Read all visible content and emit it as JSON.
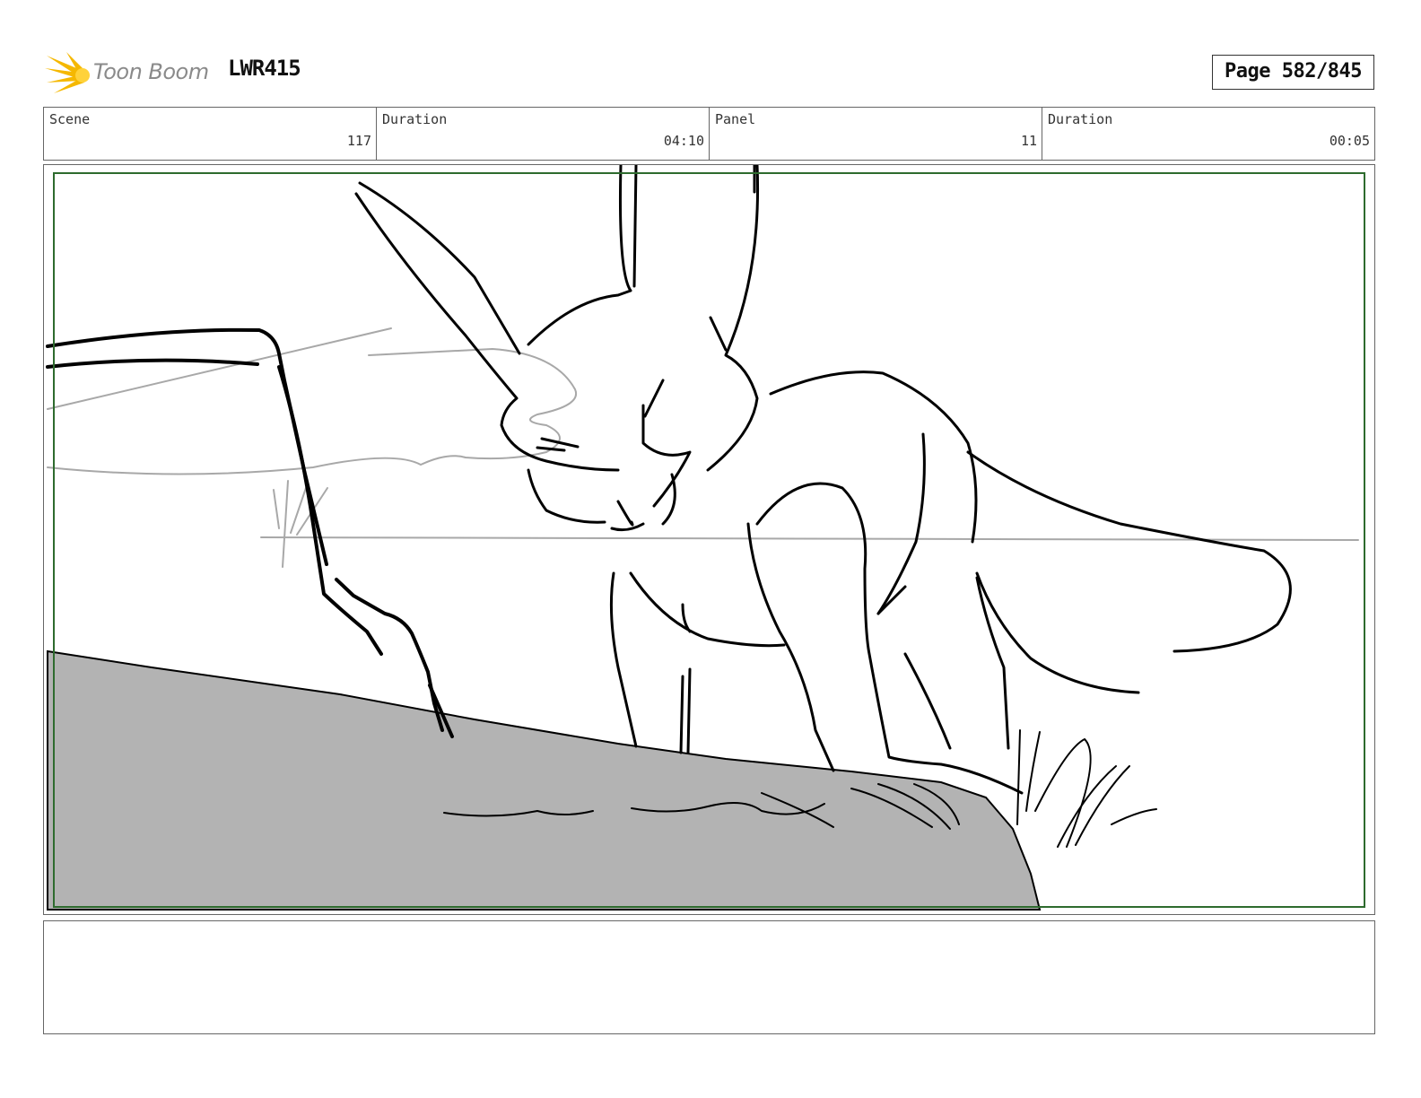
{
  "header": {
    "logo_text": "Toon Boom",
    "logo_icon": "starburst-logo-icon",
    "project_code": "LWR415",
    "page_label": "Page 582/845"
  },
  "info": {
    "scene_label": "Scene",
    "scene_value": "117",
    "scene_duration_label": "Duration",
    "scene_duration_value": "04:10",
    "panel_label": "Panel",
    "panel_value": "11",
    "panel_duration_label": "Duration",
    "panel_duration_value": "00:05"
  },
  "panel": {
    "image": "storyboard-sketch-fennec-fox-on-rock",
    "safe_frame_color": "#2e6b2e",
    "rock_fill_color": "#b3b3b3"
  },
  "notes": {
    "text": ""
  }
}
